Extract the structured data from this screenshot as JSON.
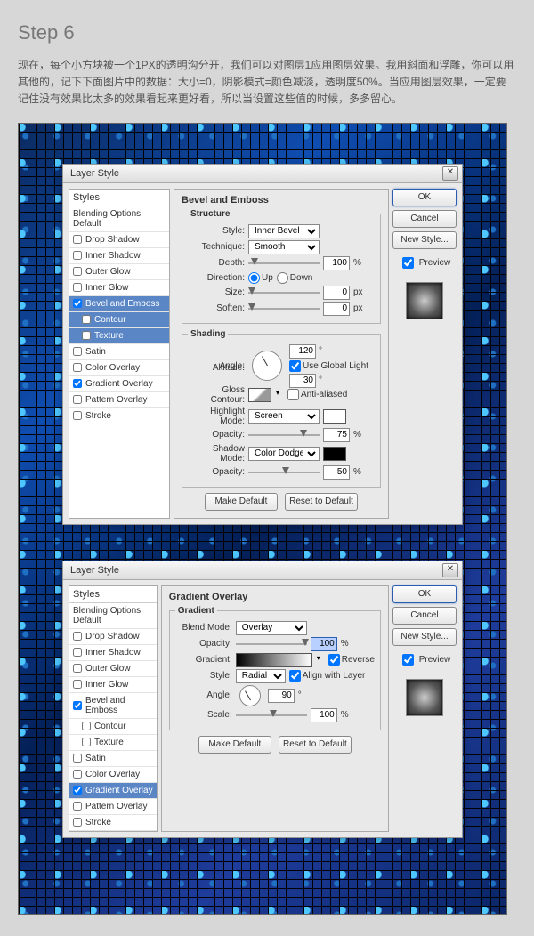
{
  "step": {
    "title": "Step 6",
    "desc": "现在，每个小方块被一个1PX的透明沟分开，我们可以对图层1应用图层效果。我用斜面和浮雕，你可以用其他的，记下下面图片中的数据：大小=0，阴影模式=颜色减淡，透明度50%。当应用图层效果，一定要记住没有效果比太多的效果看起来更好看，所以当设置这些值的时候，多多留心。"
  },
  "dlgA": {
    "title": "Layer Style",
    "panel_title": "Bevel and Emboss",
    "btns": {
      "ok": "OK",
      "cancel": "Cancel",
      "new_style": "New Style...",
      "preview": "Preview"
    },
    "styles": {
      "hdr": "Styles",
      "blend": "Blending Options: Default",
      "drop_shadow": "Drop Shadow",
      "inner_shadow": "Inner Shadow",
      "outer_glow": "Outer Glow",
      "inner_glow": "Inner Glow",
      "bevel": "Bevel and Emboss",
      "contour": "Contour",
      "texture": "Texture",
      "satin": "Satin",
      "color_overlay": "Color Overlay",
      "gradient_overlay": "Gradient Overlay",
      "pattern_overlay": "Pattern Overlay",
      "stroke": "Stroke"
    },
    "structure": {
      "legend": "Structure",
      "style_lbl": "Style:",
      "style_val": "Inner Bevel",
      "technique_lbl": "Technique:",
      "technique_val": "Smooth",
      "depth_lbl": "Depth:",
      "depth_val": "100",
      "depth_unit": "%",
      "direction_lbl": "Direction:",
      "dir_up": "Up",
      "dir_down": "Down",
      "size_lbl": "Size:",
      "size_val": "0",
      "size_unit": "px",
      "soften_lbl": "Soften:",
      "soften_val": "0",
      "soften_unit": "px"
    },
    "shading": {
      "legend": "Shading",
      "angle_lbl": "Angle:",
      "angle_val": "120",
      "deg": "°",
      "use_global": "Use Global Light",
      "altitude_lbl": "Altitude:",
      "altitude_val": "30",
      "gloss_lbl": "Gloss Contour:",
      "anti_aliased": "Anti-aliased",
      "highlight_lbl": "Highlight Mode:",
      "highlight_val": "Screen",
      "opacity_lbl": "Opacity:",
      "hl_opacity_val": "75",
      "shadow_lbl": "Shadow Mode:",
      "shadow_val": "Color Dodge",
      "sh_opacity_val": "50",
      "pct": "%"
    },
    "footer": {
      "make_default": "Make Default",
      "reset": "Reset to Default"
    }
  },
  "dlgB": {
    "title": "Layer Style",
    "panel_title": "Gradient Overlay",
    "btns": {
      "ok": "OK",
      "cancel": "Cancel",
      "new_style": "New Style...",
      "preview": "Preview"
    },
    "styles": {
      "hdr": "Styles",
      "blend": "Blending Options: Default",
      "drop_shadow": "Drop Shadow",
      "inner_shadow": "Inner Shadow",
      "outer_glow": "Outer Glow",
      "inner_glow": "Inner Glow",
      "bevel": "Bevel and Emboss",
      "contour": "Contour",
      "texture": "Texture",
      "satin": "Satin",
      "color_overlay": "Color Overlay",
      "gradient_overlay": "Gradient Overlay",
      "pattern_overlay": "Pattern Overlay",
      "stroke": "Stroke"
    },
    "gradient": {
      "legend": "Gradient",
      "blend_lbl": "Blend Mode:",
      "blend_val": "Overlay",
      "opacity_lbl": "Opacity:",
      "opacity_val": "100",
      "pct": "%",
      "gradient_lbl": "Gradient:",
      "reverse": "Reverse",
      "style_lbl": "Style:",
      "style_val": "Radial",
      "align": "Align with Layer",
      "angle_lbl": "Angle:",
      "angle_val": "90",
      "deg": "°",
      "scale_lbl": "Scale:",
      "scale_val": "100"
    },
    "footer": {
      "make_default": "Make Default",
      "reset": "Reset to Default"
    }
  }
}
